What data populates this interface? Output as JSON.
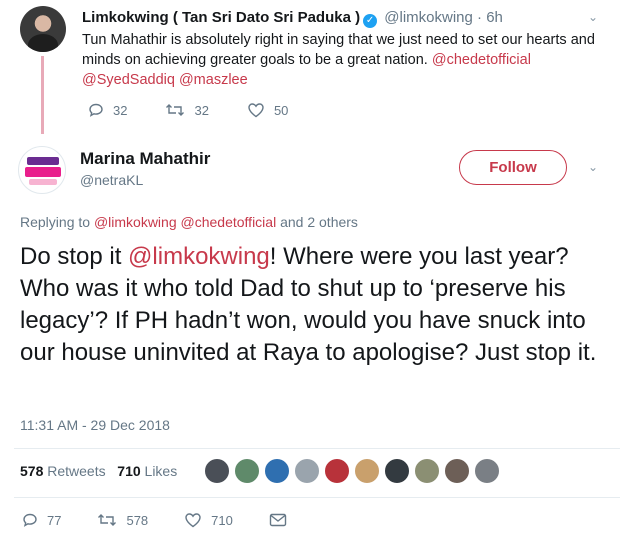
{
  "quoted_tweet": {
    "name": "Limkokwing ( Tan Sri Dato Sri Paduka )",
    "handle": "@limkokwing",
    "separator": "·",
    "time": "6h",
    "text_segments": [
      {
        "text": "Tun Mahathir is absolutely right in saying that we just need to set our hearts and minds on achieving greater goals to be a great nation.  ",
        "type": "plain"
      },
      {
        "text": "@chedetofficial",
        "type": "mention"
      },
      {
        "text": " ",
        "type": "plain"
      },
      {
        "text": "@SyedSaddiq",
        "type": "mention"
      },
      {
        "text": " ",
        "type": "plain"
      },
      {
        "text": "@maszlee",
        "type": "mention"
      }
    ],
    "replies": "32",
    "retweets": "32",
    "likes": "50"
  },
  "main_tweet": {
    "name": "Marina Mahathir",
    "handle": "@netraKL",
    "follow_label": "Follow",
    "replying_prefix": "Replying to ",
    "replying_mention_1": "@limkokwing",
    "replying_mention_2": "@chedetofficial",
    "replying_suffix": " and 2 others",
    "text_before": "Do stop it ",
    "text_mention": "@limkokwing",
    "text_after": "! Where were you last year? Who was it who told Dad to shut up to ‘preserve his legacy’? If PH hadn’t won, would you have snuck into our house uninvited at Raya to apologise? Just stop it.",
    "timestamp": "11:31 AM - 29 Dec 2018",
    "retweet_count": "578",
    "retweet_label": "Retweets",
    "like_count": "710",
    "like_label": "Likes",
    "replies": "77",
    "retweets": "578",
    "likes": "710"
  },
  "liker_avatars": [
    "#4a4f57",
    "#5f8a6a",
    "#2f6fb0",
    "#9aa4ad",
    "#b8323a",
    "#c9a06c",
    "#333a40",
    "#8b8f73",
    "#6d5f57",
    "#7a7f85"
  ],
  "colors": {
    "accent": "#c7394b",
    "thread_line": "#e8aab8",
    "verified": "#1da1f2"
  }
}
